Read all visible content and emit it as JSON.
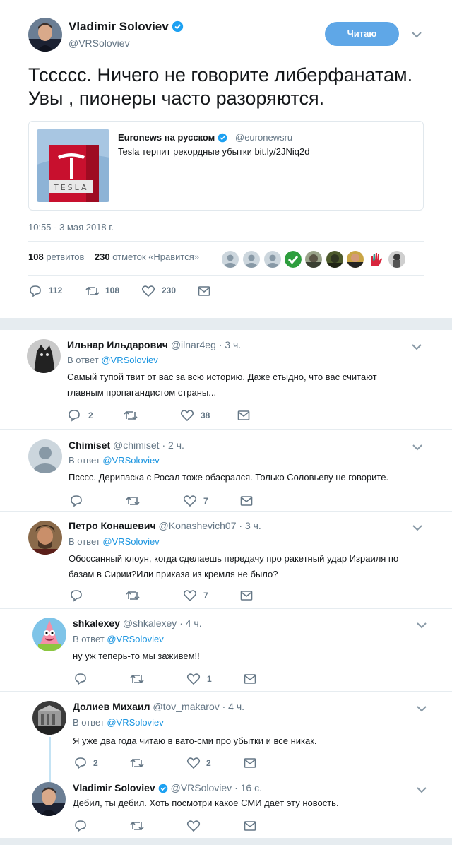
{
  "tweet": {
    "author_name": "Vladimir Soloviev",
    "author_handle": "@VRSoloviev",
    "follow_label": "Читаю",
    "text_line1": "Тсссcс. Ничего не говорите либерфанатам.",
    "text_line2": "Увы , пионеры часто разоряются.",
    "quote": {
      "name": "Euronews на русском",
      "handle": "@euronewsru",
      "text": "Tesla терпит рекордные убытки bit.ly/2JNiq2d"
    },
    "timestamp": "10:55 - 3 мая 2018 г.",
    "retweets_count": "108",
    "retweets_label": "ретвитов",
    "likes_count": "230",
    "likes_label": "отметок «Нравится»",
    "actions": {
      "replies": "112",
      "retweets": "108",
      "likes": "230"
    }
  },
  "replies": [
    {
      "name": "Ильнар Ильдарович",
      "handle": "@ilnar4eg · 3 ч.",
      "reply_to_prefix": "В ответ",
      "reply_to": "@VRSoloviev",
      "text_lines": [
        "Самый тупой твит от вас за всю историю. Даже стыдно, что вас считают",
        "главным пропагандистом страны..."
      ],
      "reply_count": "2",
      "retweet_count": "",
      "like_count": "38"
    },
    {
      "name": "Chimiset",
      "handle": "@chimiset · 2 ч.",
      "reply_to_prefix": "В ответ",
      "reply_to": "@VRSoloviev",
      "text_lines": [
        "Псссс. Дерипаска с Росал тоже обасрался. Только Соловьеву не говорите."
      ],
      "reply_count": "",
      "retweet_count": "",
      "like_count": "7"
    },
    {
      "name": "Петро Конашевич",
      "handle": "@Konashevich07 · 3 ч.",
      "reply_to_prefix": "В ответ",
      "reply_to": "@VRSoloviev",
      "text_lines": [
        "Обоссанный клоун, когда сделаешь передачу про ракетный удар Израиля по",
        "базам в Сирии?Или приказа из кремля не было?"
      ],
      "reply_count": "",
      "retweet_count": "",
      "like_count": "7"
    },
    {
      "name": "shkalexey",
      "handle": "@shkalexey · 4 ч.",
      "reply_to_prefix": "В ответ",
      "reply_to": "@VRSoloviev",
      "text_lines": [
        "ну уж теперь-то мы заживем!!"
      ],
      "reply_count": "",
      "retweet_count": "",
      "like_count": "1"
    },
    {
      "name": "Долиев Михаил",
      "handle": "@tov_makarov · 4 ч.",
      "reply_to_prefix": "В ответ",
      "reply_to": "@VRSoloviev",
      "text_lines": [
        "Я уже два года читаю в вато-сми про убытки и все никак."
      ],
      "reply_count": "2",
      "retweet_count": "",
      "like_count": "2"
    },
    {
      "name": "Vladimir Soloviev",
      "handle": "@VRSoloviev · 16 с.",
      "text_lines": [
        "Дебил, ты дебил. Хоть посмотри какое СМИ даёт эту новость."
      ],
      "reply_count": "",
      "retweet_count": "",
      "like_count": ""
    }
  ],
  "icons": {
    "reply": "reply-icon",
    "retweet": "retweet-icon",
    "like": "heart-icon",
    "dm": "envelope-icon",
    "verified": "verified-badge-icon",
    "more": "chevron-down-icon"
  },
  "colors": {
    "accent": "#1da1f2",
    "follow_button": "#5fa7e7",
    "text_secondary": "#657786",
    "background": "#e6ecf0"
  }
}
